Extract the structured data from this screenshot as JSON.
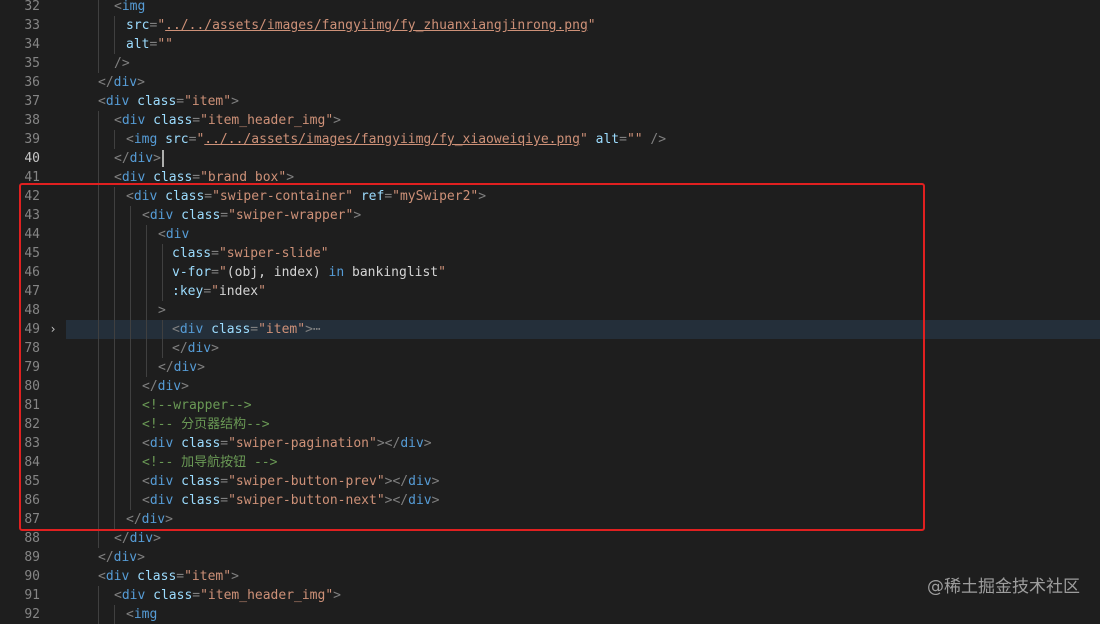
{
  "editor": {
    "cursor_line": "40",
    "lines": [
      {
        "n": "32",
        "indent": 48,
        "spans": [
          [
            "pun",
            "<"
          ],
          [
            "tag",
            "img"
          ]
        ]
      },
      {
        "n": "33",
        "indent": 60,
        "spans": [
          [
            "attr",
            "src"
          ],
          [
            "pun",
            "="
          ],
          [
            "str",
            "\""
          ],
          [
            "str link",
            "../../assets/images/fangyiimg/fy_zhuanxiangjinrong.png"
          ],
          [
            "str",
            "\""
          ]
        ]
      },
      {
        "n": "34",
        "indent": 60,
        "spans": [
          [
            "attr",
            "alt"
          ],
          [
            "pun",
            "="
          ],
          [
            "str",
            "\"\""
          ]
        ]
      },
      {
        "n": "35",
        "indent": 48,
        "spans": [
          [
            "pun",
            "/>"
          ]
        ]
      },
      {
        "n": "36",
        "indent": 32,
        "spans": [
          [
            "pun",
            "</"
          ],
          [
            "tag",
            "div"
          ],
          [
            "pun",
            ">"
          ]
        ]
      },
      {
        "n": "37",
        "indent": 32,
        "spans": [
          [
            "pun",
            "<"
          ],
          [
            "tag",
            "div"
          ],
          [
            "txt",
            " "
          ],
          [
            "attr",
            "class"
          ],
          [
            "pun",
            "="
          ],
          [
            "str",
            "\"item\""
          ],
          [
            "pun",
            ">"
          ]
        ]
      },
      {
        "n": "38",
        "indent": 48,
        "spans": [
          [
            "pun",
            "<"
          ],
          [
            "tag",
            "div"
          ],
          [
            "txt",
            " "
          ],
          [
            "attr",
            "class"
          ],
          [
            "pun",
            "="
          ],
          [
            "str",
            "\"item_header_img\""
          ],
          [
            "pun",
            ">"
          ]
        ]
      },
      {
        "n": "39",
        "indent": 60,
        "spans": [
          [
            "pun",
            "<"
          ],
          [
            "tag",
            "img"
          ],
          [
            "txt",
            " "
          ],
          [
            "attr",
            "src"
          ],
          [
            "pun",
            "="
          ],
          [
            "str",
            "\""
          ],
          [
            "str link",
            "../../assets/images/fangyiimg/fy_xiaoweiqiye.png"
          ],
          [
            "str",
            "\""
          ],
          [
            "txt",
            " "
          ],
          [
            "attr",
            "alt"
          ],
          [
            "pun",
            "="
          ],
          [
            "str",
            "\"\""
          ],
          [
            "txt",
            " "
          ],
          [
            "pun",
            "/>"
          ]
        ]
      },
      {
        "n": "40",
        "indent": 48,
        "spans": [
          [
            "pun",
            "</"
          ],
          [
            "tag",
            "div"
          ],
          [
            "pun",
            ">"
          ]
        ]
      },
      {
        "n": "41",
        "indent": 48,
        "spans": [
          [
            "pun",
            "<"
          ],
          [
            "tag",
            "div"
          ],
          [
            "txt",
            " "
          ],
          [
            "attr",
            "class"
          ],
          [
            "pun",
            "="
          ],
          [
            "str",
            "\"brand_box\""
          ],
          [
            "pun",
            ">"
          ]
        ]
      },
      {
        "n": "42",
        "indent": 60,
        "spans": [
          [
            "pun",
            "<"
          ],
          [
            "tag",
            "div"
          ],
          [
            "txt",
            " "
          ],
          [
            "attr",
            "class"
          ],
          [
            "pun",
            "="
          ],
          [
            "str",
            "\"swiper-container\""
          ],
          [
            "txt",
            " "
          ],
          [
            "attr",
            "ref"
          ],
          [
            "pun",
            "="
          ],
          [
            "str",
            "\"mySwiper2\""
          ],
          [
            "pun",
            ">"
          ]
        ]
      },
      {
        "n": "43",
        "indent": 76,
        "spans": [
          [
            "pun",
            "<"
          ],
          [
            "tag",
            "div"
          ],
          [
            "txt",
            " "
          ],
          [
            "attr",
            "class"
          ],
          [
            "pun",
            "="
          ],
          [
            "str",
            "\"swiper-wrapper\""
          ],
          [
            "pun",
            ">"
          ]
        ]
      },
      {
        "n": "44",
        "indent": 92,
        "spans": [
          [
            "pun",
            "<"
          ],
          [
            "tag",
            "div"
          ]
        ]
      },
      {
        "n": "45",
        "indent": 106,
        "spans": [
          [
            "attr",
            "class"
          ],
          [
            "pun",
            "="
          ],
          [
            "str",
            "\"swiper-slide\""
          ]
        ]
      },
      {
        "n": "46",
        "indent": 106,
        "spans": [
          [
            "attr",
            "v-for"
          ],
          [
            "pun",
            "="
          ],
          [
            "str",
            "\""
          ],
          [
            "txt",
            "(obj, index) "
          ],
          [
            "kw",
            "in"
          ],
          [
            "txt",
            " bankinglist"
          ],
          [
            "str",
            "\""
          ]
        ]
      },
      {
        "n": "47",
        "indent": 106,
        "spans": [
          [
            "attr",
            ":key"
          ],
          [
            "pun",
            "="
          ],
          [
            "str",
            "\""
          ],
          [
            "txt",
            "index"
          ],
          [
            "str",
            "\""
          ]
        ]
      },
      {
        "n": "48",
        "indent": 92,
        "spans": [
          [
            "pun",
            ">"
          ]
        ]
      },
      {
        "n": "49",
        "indent": 106,
        "fold": true,
        "spans": [
          [
            "pun",
            "<"
          ],
          [
            "tag",
            "div"
          ],
          [
            "txt",
            " "
          ],
          [
            "attr",
            "class"
          ],
          [
            "pun",
            "="
          ],
          [
            "str",
            "\"item\""
          ],
          [
            "pun",
            ">"
          ],
          [
            "pun",
            "⋯"
          ]
        ]
      },
      {
        "n": "78",
        "indent": 106,
        "spans": [
          [
            "pun",
            "</"
          ],
          [
            "tag",
            "div"
          ],
          [
            "pun",
            ">"
          ]
        ]
      },
      {
        "n": "79",
        "indent": 92,
        "spans": [
          [
            "pun",
            "</"
          ],
          [
            "tag",
            "div"
          ],
          [
            "pun",
            ">"
          ]
        ]
      },
      {
        "n": "80",
        "indent": 76,
        "spans": [
          [
            "pun",
            "</"
          ],
          [
            "tag",
            "div"
          ],
          [
            "pun",
            ">"
          ]
        ]
      },
      {
        "n": "81",
        "indent": 76,
        "spans": [
          [
            "cmt",
            "<!--wrapper-->"
          ]
        ]
      },
      {
        "n": "82",
        "indent": 76,
        "spans": [
          [
            "cmt",
            "<!-- 分页器结构-->"
          ]
        ]
      },
      {
        "n": "83",
        "indent": 76,
        "spans": [
          [
            "pun",
            "<"
          ],
          [
            "tag",
            "div"
          ],
          [
            "txt",
            " "
          ],
          [
            "attr",
            "class"
          ],
          [
            "pun",
            "="
          ],
          [
            "str",
            "\"swiper-pagination\""
          ],
          [
            "pun",
            "></"
          ],
          [
            "tag",
            "div"
          ],
          [
            "pun",
            ">"
          ]
        ]
      },
      {
        "n": "84",
        "indent": 76,
        "spans": [
          [
            "cmt",
            "<!-- 加导航按钮 -->"
          ]
        ]
      },
      {
        "n": "85",
        "indent": 76,
        "spans": [
          [
            "pun",
            "<"
          ],
          [
            "tag",
            "div"
          ],
          [
            "txt",
            " "
          ],
          [
            "attr",
            "class"
          ],
          [
            "pun",
            "="
          ],
          [
            "str",
            "\"swiper-button-prev\""
          ],
          [
            "pun",
            "></"
          ],
          [
            "tag",
            "div"
          ],
          [
            "pun",
            ">"
          ]
        ]
      },
      {
        "n": "86",
        "indent": 76,
        "spans": [
          [
            "pun",
            "<"
          ],
          [
            "tag",
            "div"
          ],
          [
            "txt",
            " "
          ],
          [
            "attr",
            "class"
          ],
          [
            "pun",
            "="
          ],
          [
            "str",
            "\"swiper-button-next\""
          ],
          [
            "pun",
            "></"
          ],
          [
            "tag",
            "div"
          ],
          [
            "pun",
            ">"
          ]
        ]
      },
      {
        "n": "87",
        "indent": 60,
        "spans": [
          [
            "pun",
            "</"
          ],
          [
            "tag",
            "div"
          ],
          [
            "pun",
            ">"
          ]
        ]
      },
      {
        "n": "88",
        "indent": 48,
        "spans": [
          [
            "pun",
            "</"
          ],
          [
            "tag",
            "div"
          ],
          [
            "pun",
            ">"
          ]
        ]
      },
      {
        "n": "89",
        "indent": 32,
        "spans": [
          [
            "pun",
            "</"
          ],
          [
            "tag",
            "div"
          ],
          [
            "pun",
            ">"
          ]
        ]
      },
      {
        "n": "90",
        "indent": 32,
        "spans": [
          [
            "pun",
            "<"
          ],
          [
            "tag",
            "div"
          ],
          [
            "txt",
            " "
          ],
          [
            "attr",
            "class"
          ],
          [
            "pun",
            "="
          ],
          [
            "str",
            "\"item\""
          ],
          [
            "pun",
            ">"
          ]
        ]
      },
      {
        "n": "91",
        "indent": 48,
        "spans": [
          [
            "pun",
            "<"
          ],
          [
            "tag",
            "div"
          ],
          [
            "txt",
            " "
          ],
          [
            "attr",
            "class"
          ],
          [
            "pun",
            "="
          ],
          [
            "str",
            "\"item_header_img\""
          ],
          [
            "pun",
            ">"
          ]
        ]
      },
      {
        "n": "92",
        "indent": 60,
        "spans": [
          [
            "pun",
            "<"
          ],
          [
            "tag",
            "img"
          ]
        ]
      }
    ]
  },
  "highlight_color": "#e02020",
  "watermark": "@稀土掘金技术社区"
}
